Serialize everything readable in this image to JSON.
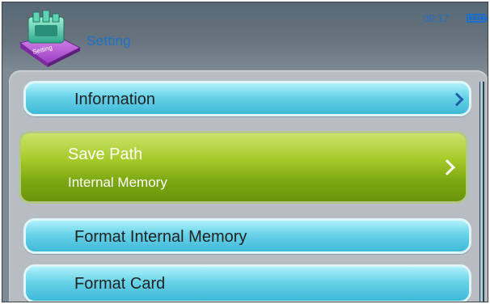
{
  "header": {
    "icon_name": "settings-app-icon",
    "icon_caption": "Setting",
    "title": "Setting",
    "clock": "09:17",
    "battery_icon": "battery-icon"
  },
  "menu": {
    "items": [
      {
        "label": "Information",
        "icon": "chevron-right-icon",
        "selected": false
      },
      {
        "label": "Save Path",
        "value": "Internal Memory",
        "icon": "chevron-right-icon",
        "selected": true
      },
      {
        "label": "Format Internal Memory",
        "selected": false
      },
      {
        "label": "Format Card",
        "selected": false
      }
    ]
  },
  "colors": {
    "accent": "#1b73c9",
    "selected_item": "#8bb61a",
    "item": "#5fcde6"
  }
}
